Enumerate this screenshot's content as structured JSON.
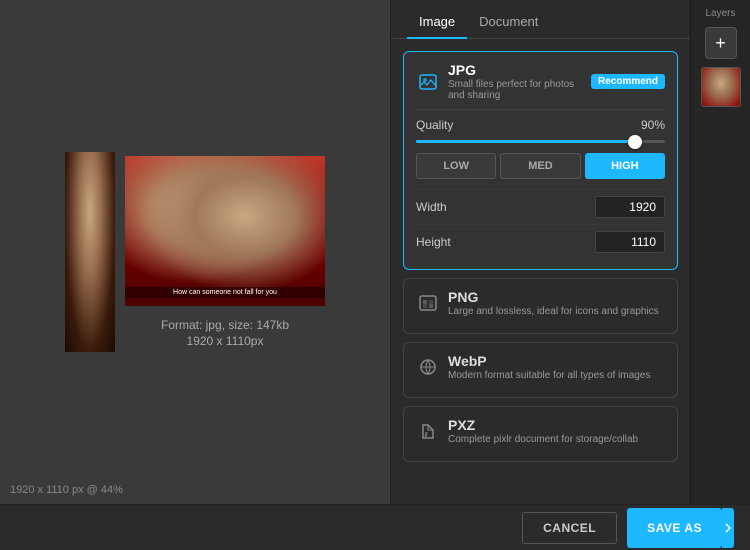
{
  "tabs": {
    "image_label": "Image",
    "document_label": "Document"
  },
  "formats": {
    "jpg": {
      "name": "JPG",
      "description": "Small files perfect for photos and sharing",
      "recommend_label": "Recommend",
      "selected": true
    },
    "png": {
      "name": "PNG",
      "description": "Large and lossless, ideal for icons and graphics",
      "selected": false
    },
    "webp": {
      "name": "WebP",
      "description": "Modern format suitable for all types of images",
      "selected": false
    },
    "pxz": {
      "name": "PXZ",
      "description": "Complete pixlr document for storage/collab",
      "selected": false
    }
  },
  "quality": {
    "label": "Quality",
    "value": "90%",
    "slider_percent": 90,
    "buttons": {
      "low": "LOW",
      "med": "MED",
      "high": "HIGH"
    },
    "active_button": "high"
  },
  "dimensions": {
    "width_label": "Width",
    "width_value": "1920",
    "height_label": "Height",
    "height_value": "1110"
  },
  "image_info": {
    "format_line": "Format: jpg, size: 147kb",
    "dimensions_line": "1920 x 1110px"
  },
  "canvas_status": "1920 x 1110 px @ 44%",
  "layers": {
    "title": "Layers"
  },
  "buttons": {
    "cancel": "CANCEL",
    "save_as": "SAVE AS"
  }
}
